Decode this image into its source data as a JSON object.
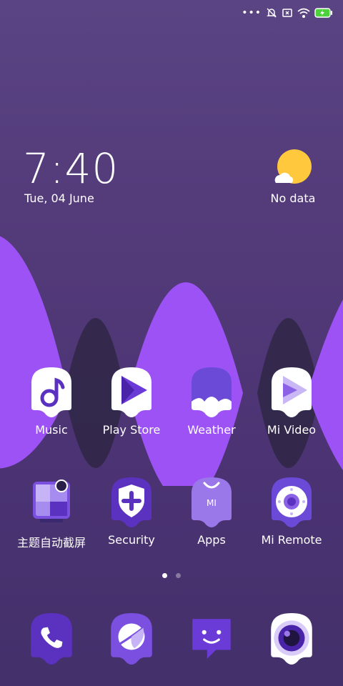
{
  "status_bar": {
    "more": "•••"
  },
  "clock": {
    "time": "7:40",
    "date": "Tue, 04 June"
  },
  "weather": {
    "label": "No data"
  },
  "home_row1": [
    {
      "label": "Music",
      "icon": "music-note-icon"
    },
    {
      "label": "Play Store",
      "icon": "play-store-icon"
    },
    {
      "label": "Weather",
      "icon": "weather-icon"
    },
    {
      "label": "Mi Video",
      "icon": "mi-video-icon"
    }
  ],
  "home_row2": [
    {
      "label": "主题自动截屏",
      "icon": "theme-screenshot-icon"
    },
    {
      "label": "Security",
      "icon": "security-shield-icon"
    },
    {
      "label": "Apps",
      "icon": "apps-bag-icon",
      "badge": "MI"
    },
    {
      "label": "Mi Remote",
      "icon": "mi-remote-icon"
    }
  ],
  "dock": [
    {
      "name": "phone",
      "icon": "phone-icon"
    },
    {
      "name": "browser",
      "icon": "browser-planet-icon"
    },
    {
      "name": "messages",
      "icon": "messages-icon"
    },
    {
      "name": "camera",
      "icon": "camera-icon"
    }
  ],
  "pager": {
    "pages": 2,
    "active": 0
  },
  "colors": {
    "accent": "#9b59f0",
    "icon_purple": "#5b32c0",
    "icon_white": "#ffffff",
    "sun": "#ffc83d"
  }
}
